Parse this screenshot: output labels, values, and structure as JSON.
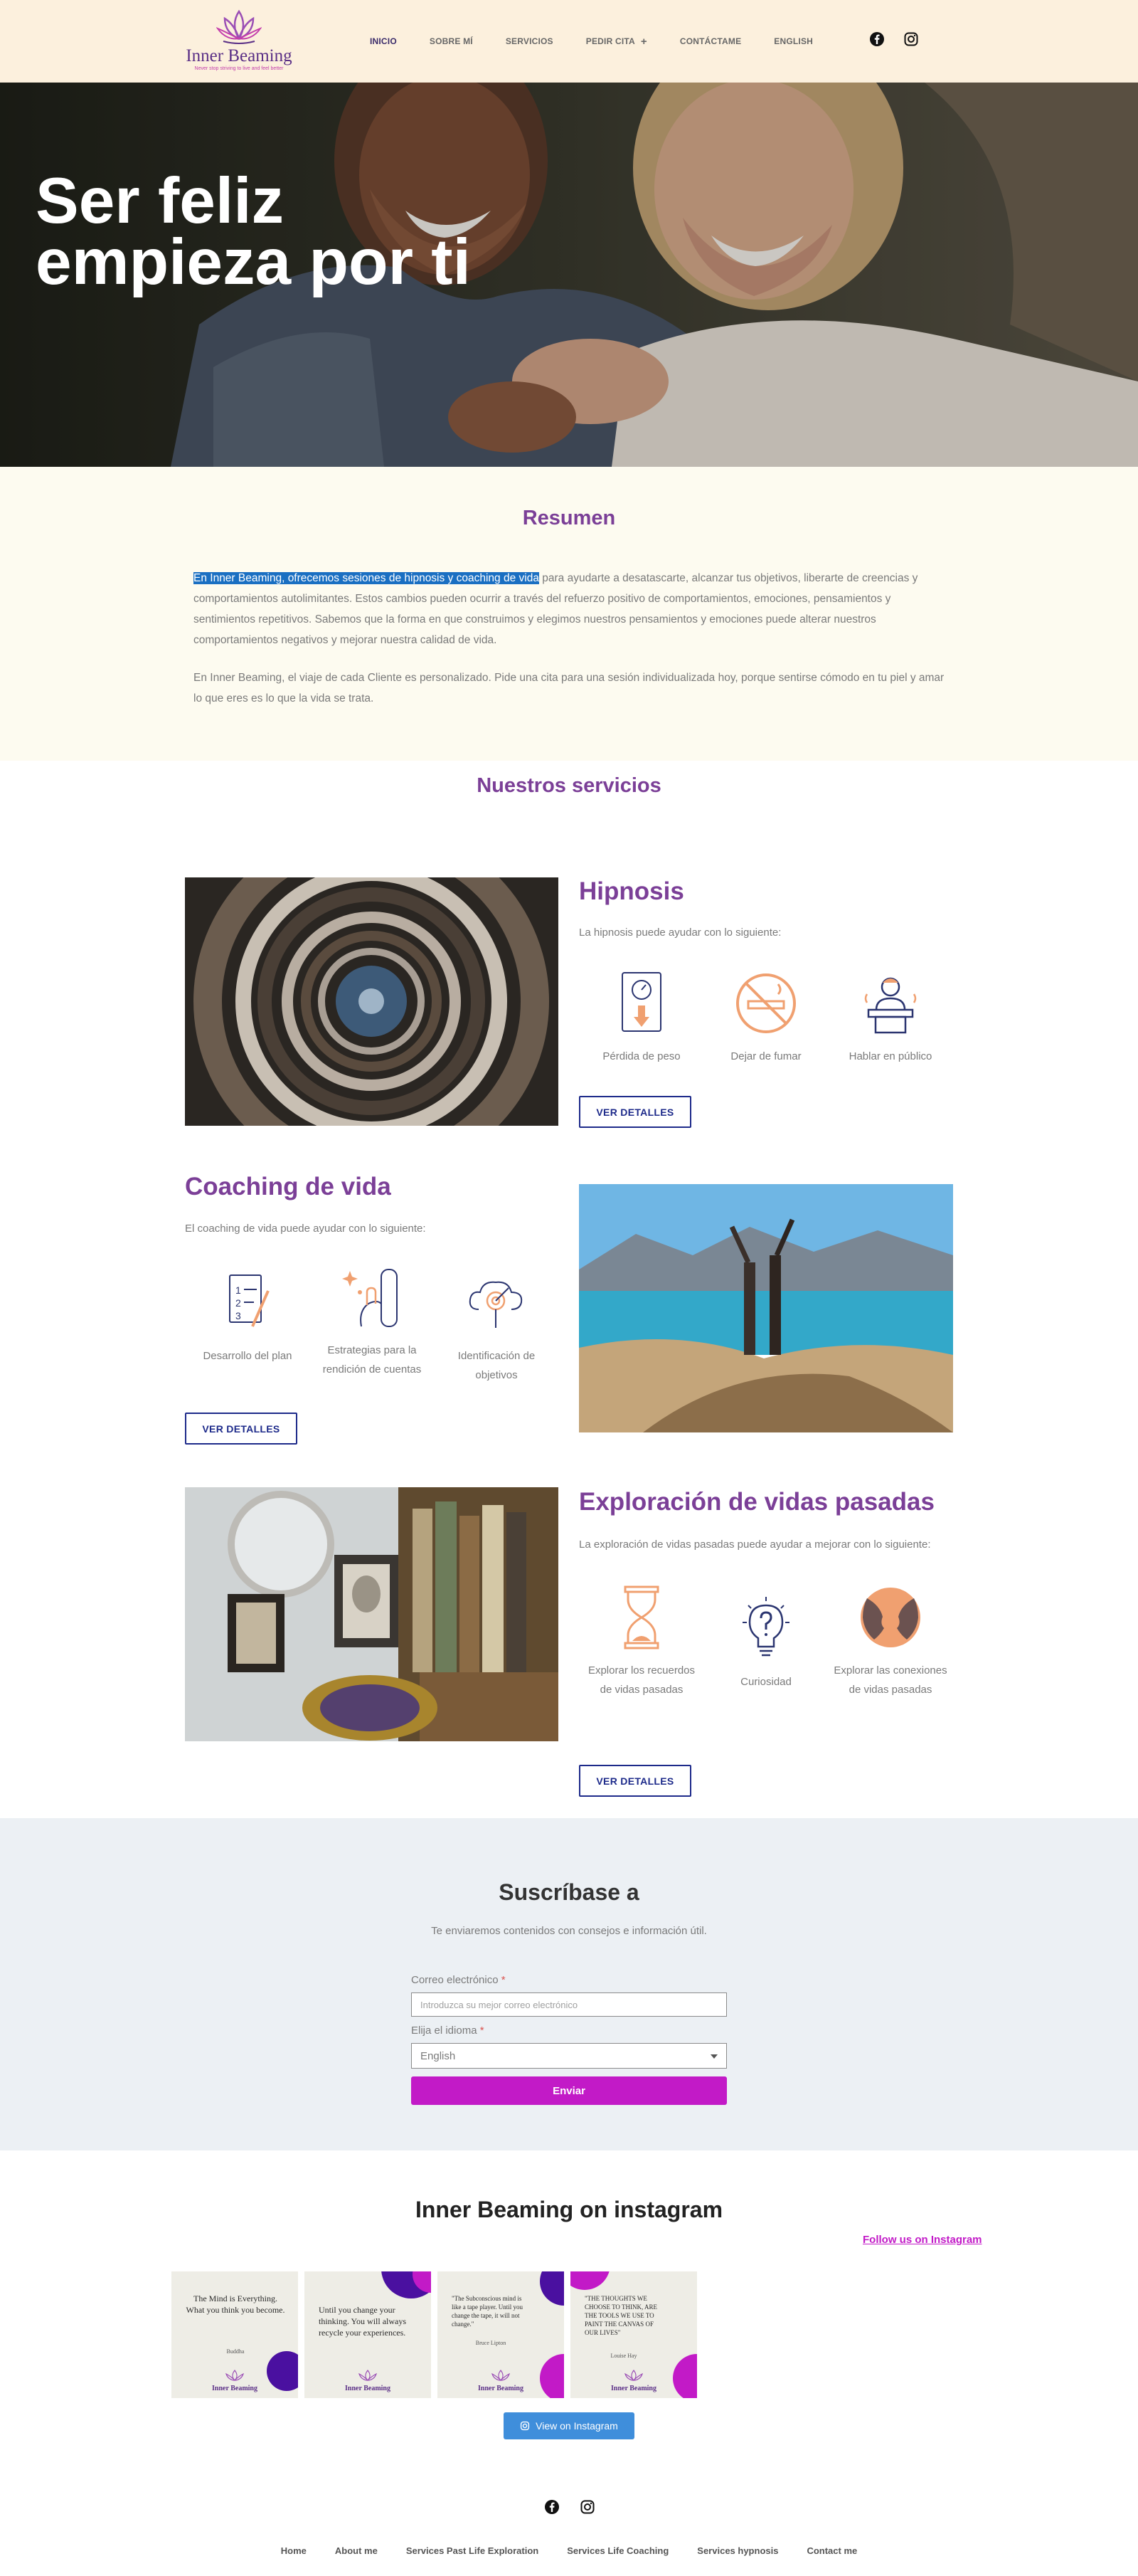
{
  "header": {
    "logo_name": "Inner Beaming",
    "logo_tagline": "Never stop striving to live and feel better",
    "nav": [
      {
        "label": "Inicio",
        "active": true
      },
      {
        "label": "Sobre mí"
      },
      {
        "label": "Servicios"
      },
      {
        "label": "Pedir cita",
        "has_submenu": true
      },
      {
        "label": "Contáctame"
      },
      {
        "label": "English"
      }
    ],
    "plus": "+",
    "social_icons": [
      "facebook-icon",
      "instagram-icon"
    ]
  },
  "hero": {
    "title": "Ser feliz empieza por ti"
  },
  "resumen": {
    "title": "Resumen",
    "p1_highlight": "En Inner Beaming, ofrecemos sesiones de hipnosis y coaching de vida",
    "p1_rest": " para ayudarte a desatascarte, alcanzar tus objetivos, liberarte de creencias y comportamientos autolimitantes. Estos cambios pueden ocurrir a través del refuerzo positivo de comportamientos, emociones, pensamientos y sentimientos repetitivos. Sabemos que la forma en que construimos y elegimos nuestros pensamientos y emociones puede alterar nuestros comportamientos negativos y mejorar nuestra calidad de vida.",
    "p2": " En Inner Beaming, el viaje de cada Cliente es personalizado. Pide una cita para una sesión individualizada hoy, porque sentirse cómodo en tu piel y amar lo que eres es lo que la vida se trata."
  },
  "servicios": {
    "title": "Nuestros servicios",
    "items": [
      {
        "title": "Hipnosis",
        "intro": "La hipnosis puede ayudar con lo siguiente:",
        "features": [
          "Pérdida de peso",
          "Dejar de fumar",
          "Hablar en público"
        ],
        "button": "VER DETALLES"
      },
      {
        "title": "Coaching de vida",
        "intro": "El coaching de vida puede ayudar con lo siguiente:",
        "features": [
          "Desarrollo del plan",
          "Estrategias para la rendición de cuentas",
          "Identificación de objetivos"
        ],
        "button": "VER DETALLES"
      },
      {
        "title": "Exploración de vidas pasadas",
        "intro": "La exploración de vidas pasadas puede ayudar a mejorar con lo siguiente:",
        "features": [
          "Explorar los recuerdos de vidas pasadas",
          "Curiosidad",
          "Explorar las conexiones de vidas pasadas"
        ],
        "button": "VER DETALLES"
      }
    ]
  },
  "subscribe": {
    "title": "Suscríbase a",
    "description": "Te enviaremos contenidos con consejos e información útil.",
    "email_label": "Correo electrónico",
    "email_placeholder": "Introduzca su mejor correo electrónico",
    "language_label": "Elija el idioma",
    "language_value": "English",
    "required_mark": "*",
    "submit": "Enviar"
  },
  "instagram": {
    "title": "Inner Beaming on instagram",
    "follow": "Follow us on Instagram",
    "posts": [
      {
        "quote": "The Mind is Everything. What you think you become.",
        "author": "Buddha",
        "brand": "Inner Beaming"
      },
      {
        "quote": "Until you change your thinking. You will always recycle your experiences.",
        "author": "",
        "brand": "Inner Beaming"
      },
      {
        "quote": "\"The Subconscious mind is like a tape player. Until you change the tape, it will not change.\"",
        "author": "Bruce Lipton",
        "brand": "Inner Beaming"
      },
      {
        "quote": "\"THE THOUGHTS WE CHOOSE TO THINK, ARE THE TOOLS WE USE TO PAINT THE CANVAS OF OUR LIVES\"",
        "author": "Louise Hay",
        "brand": "Inner Beaming"
      }
    ],
    "view_button": "View on Instagram"
  },
  "footer": {
    "social_icons": [
      "facebook-icon",
      "instagram-icon"
    ],
    "links": [
      "Home",
      "About me",
      "Services Past Life Exploration",
      "Services Life Coaching",
      "Services hypnosis",
      "Contact me"
    ]
  },
  "colors": {
    "header_bg": "#fcf0dd",
    "accent_purple": "#7b3f97",
    "button_navy": "#1d2a8a",
    "submit_magenta": "#c21ac7",
    "icon_orange": "#f0a070",
    "icon_navy": "#2b3570"
  }
}
